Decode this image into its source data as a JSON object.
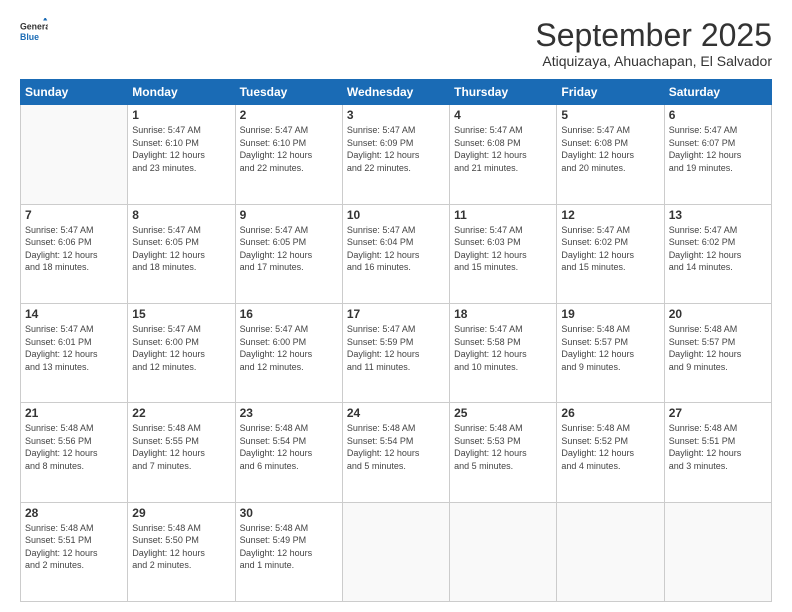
{
  "header": {
    "logo_line1": "General",
    "logo_line2": "Blue",
    "month": "September 2025",
    "location": "Atiquizaya, Ahuachapan, El Salvador"
  },
  "weekdays": [
    "Sunday",
    "Monday",
    "Tuesday",
    "Wednesday",
    "Thursday",
    "Friday",
    "Saturday"
  ],
  "weeks": [
    [
      {
        "day": null
      },
      {
        "day": 1,
        "sunrise": "5:47 AM",
        "sunset": "6:10 PM",
        "daylight": "12 hours and 23 minutes."
      },
      {
        "day": 2,
        "sunrise": "5:47 AM",
        "sunset": "6:10 PM",
        "daylight": "12 hours and 22 minutes."
      },
      {
        "day": 3,
        "sunrise": "5:47 AM",
        "sunset": "6:09 PM",
        "daylight": "12 hours and 22 minutes."
      },
      {
        "day": 4,
        "sunrise": "5:47 AM",
        "sunset": "6:08 PM",
        "daylight": "12 hours and 21 minutes."
      },
      {
        "day": 5,
        "sunrise": "5:47 AM",
        "sunset": "6:08 PM",
        "daylight": "12 hours and 20 minutes."
      },
      {
        "day": 6,
        "sunrise": "5:47 AM",
        "sunset": "6:07 PM",
        "daylight": "12 hours and 19 minutes."
      }
    ],
    [
      {
        "day": 7,
        "sunrise": "5:47 AM",
        "sunset": "6:06 PM",
        "daylight": "12 hours and 18 minutes."
      },
      {
        "day": 8,
        "sunrise": "5:47 AM",
        "sunset": "6:05 PM",
        "daylight": "12 hours and 18 minutes."
      },
      {
        "day": 9,
        "sunrise": "5:47 AM",
        "sunset": "6:05 PM",
        "daylight": "12 hours and 17 minutes."
      },
      {
        "day": 10,
        "sunrise": "5:47 AM",
        "sunset": "6:04 PM",
        "daylight": "12 hours and 16 minutes."
      },
      {
        "day": 11,
        "sunrise": "5:47 AM",
        "sunset": "6:03 PM",
        "daylight": "12 hours and 15 minutes."
      },
      {
        "day": 12,
        "sunrise": "5:47 AM",
        "sunset": "6:02 PM",
        "daylight": "12 hours and 15 minutes."
      },
      {
        "day": 13,
        "sunrise": "5:47 AM",
        "sunset": "6:02 PM",
        "daylight": "12 hours and 14 minutes."
      }
    ],
    [
      {
        "day": 14,
        "sunrise": "5:47 AM",
        "sunset": "6:01 PM",
        "daylight": "12 hours and 13 minutes."
      },
      {
        "day": 15,
        "sunrise": "5:47 AM",
        "sunset": "6:00 PM",
        "daylight": "12 hours and 12 minutes."
      },
      {
        "day": 16,
        "sunrise": "5:47 AM",
        "sunset": "6:00 PM",
        "daylight": "12 hours and 12 minutes."
      },
      {
        "day": 17,
        "sunrise": "5:47 AM",
        "sunset": "5:59 PM",
        "daylight": "12 hours and 11 minutes."
      },
      {
        "day": 18,
        "sunrise": "5:47 AM",
        "sunset": "5:58 PM",
        "daylight": "12 hours and 10 minutes."
      },
      {
        "day": 19,
        "sunrise": "5:48 AM",
        "sunset": "5:57 PM",
        "daylight": "12 hours and 9 minutes."
      },
      {
        "day": 20,
        "sunrise": "5:48 AM",
        "sunset": "5:57 PM",
        "daylight": "12 hours and 9 minutes."
      }
    ],
    [
      {
        "day": 21,
        "sunrise": "5:48 AM",
        "sunset": "5:56 PM",
        "daylight": "12 hours and 8 minutes."
      },
      {
        "day": 22,
        "sunrise": "5:48 AM",
        "sunset": "5:55 PM",
        "daylight": "12 hours and 7 minutes."
      },
      {
        "day": 23,
        "sunrise": "5:48 AM",
        "sunset": "5:54 PM",
        "daylight": "12 hours and 6 minutes."
      },
      {
        "day": 24,
        "sunrise": "5:48 AM",
        "sunset": "5:54 PM",
        "daylight": "12 hours and 5 minutes."
      },
      {
        "day": 25,
        "sunrise": "5:48 AM",
        "sunset": "5:53 PM",
        "daylight": "12 hours and 5 minutes."
      },
      {
        "day": 26,
        "sunrise": "5:48 AM",
        "sunset": "5:52 PM",
        "daylight": "12 hours and 4 minutes."
      },
      {
        "day": 27,
        "sunrise": "5:48 AM",
        "sunset": "5:51 PM",
        "daylight": "12 hours and 3 minutes."
      }
    ],
    [
      {
        "day": 28,
        "sunrise": "5:48 AM",
        "sunset": "5:51 PM",
        "daylight": "12 hours and 2 minutes."
      },
      {
        "day": 29,
        "sunrise": "5:48 AM",
        "sunset": "5:50 PM",
        "daylight": "12 hours and 2 minutes."
      },
      {
        "day": 30,
        "sunrise": "5:48 AM",
        "sunset": "5:49 PM",
        "daylight": "12 hours and 1 minute."
      },
      {
        "day": null
      },
      {
        "day": null
      },
      {
        "day": null
      },
      {
        "day": null
      }
    ]
  ]
}
